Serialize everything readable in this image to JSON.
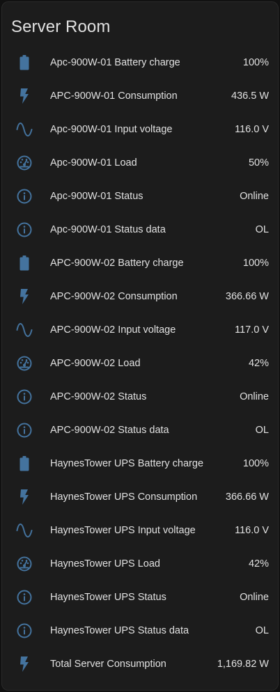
{
  "card": {
    "title": "Server Room",
    "icon_color": "#44739e",
    "rows": [
      {
        "icon": "battery-icon",
        "label": "Apc-900W-01 Battery charge",
        "value": "100%"
      },
      {
        "icon": "flash-icon",
        "label": "APC-900W-01 Consumption",
        "value": "436.5 W"
      },
      {
        "icon": "sine-wave-icon",
        "label": "Apc-900W-01 Input voltage",
        "value": "116.0 V"
      },
      {
        "icon": "gauge-icon",
        "label": "Apc-900W-01 Load",
        "value": "50%"
      },
      {
        "icon": "info-icon",
        "label": "Apc-900W-01 Status",
        "value": "Online"
      },
      {
        "icon": "info-icon",
        "label": "Apc-900W-01 Status data",
        "value": "OL"
      },
      {
        "icon": "battery-icon",
        "label": "APC-900W-02 Battery charge",
        "value": "100%"
      },
      {
        "icon": "flash-icon",
        "label": "APC-900W-02 Consumption",
        "value": "366.66 W"
      },
      {
        "icon": "sine-wave-icon",
        "label": "APC-900W-02 Input voltage",
        "value": "117.0 V"
      },
      {
        "icon": "gauge-icon",
        "label": "APC-900W-02 Load",
        "value": "42%"
      },
      {
        "icon": "info-icon",
        "label": "APC-900W-02 Status",
        "value": "Online"
      },
      {
        "icon": "info-icon",
        "label": "APC-900W-02 Status data",
        "value": "OL"
      },
      {
        "icon": "battery-icon",
        "label": "HaynesTower UPS Battery charge",
        "value": "100%"
      },
      {
        "icon": "flash-icon",
        "label": "HaynesTower UPS Consumption",
        "value": "366.66 W"
      },
      {
        "icon": "sine-wave-icon",
        "label": "HaynesTower UPS Input voltage",
        "value": "116.0 V"
      },
      {
        "icon": "gauge-icon",
        "label": "HaynesTower UPS Load",
        "value": "42%"
      },
      {
        "icon": "info-icon",
        "label": "HaynesTower UPS Status",
        "value": "Online"
      },
      {
        "icon": "info-icon",
        "label": "HaynesTower UPS Status data",
        "value": "OL"
      },
      {
        "icon": "flash-icon",
        "label": "Total Server Consumption",
        "value": "1,169.82 W"
      }
    ]
  }
}
